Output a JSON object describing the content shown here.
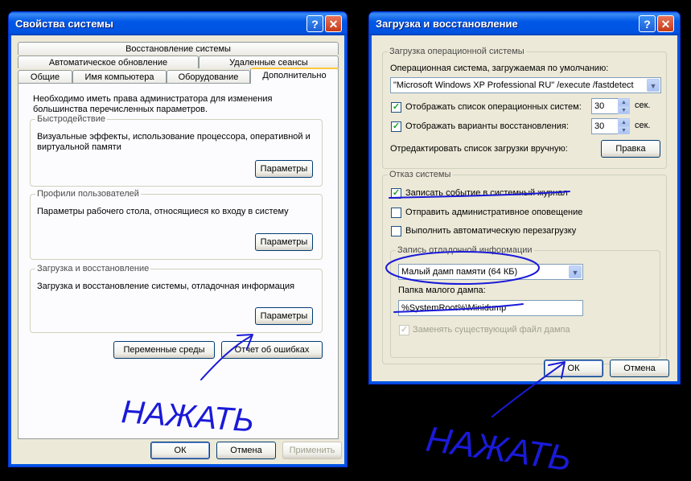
{
  "left_window": {
    "title": "Свойства системы",
    "help_btn": "?",
    "close_btn": "✕",
    "tabs": {
      "row1": [
        "Восстановление системы"
      ],
      "row2": [
        "Автоматическое обновление",
        "Удаленные сеансы"
      ],
      "row3": [
        "Общие",
        "Имя компьютера",
        "Оборудование",
        "Дополнительно"
      ]
    },
    "intro": "Необходимо иметь права администратора для изменения большинства перечисленных параметров.",
    "performance": {
      "title": "Быстродействие",
      "desc": "Визуальные эффекты, использование процессора, оперативной и виртуальной памяти",
      "button": "Параметры"
    },
    "profiles": {
      "title": "Профили пользователей",
      "desc": "Параметры рабочего стола, относящиеся ко входу в систему",
      "button": "Параметры"
    },
    "startup": {
      "title": "Загрузка и восстановление",
      "desc": "Загрузка и восстановление системы, отладочная информация",
      "button": "Параметры"
    },
    "env_button": "Переменные среды",
    "error_button": "Отчет об ошибках",
    "ok": "ОК",
    "cancel": "Отмена",
    "apply": "Применить"
  },
  "right_window": {
    "title": "Загрузка и восстановление",
    "help_btn": "?",
    "close_btn": "✕",
    "os_group": {
      "title": "Загрузка операционной системы",
      "default_os_label": "Операционная система, загружаемая по умолчанию:",
      "default_os_value": "\"Microsoft Windows XP Professional RU\" /execute /fastdetect",
      "show_list_label": "Отображать список операционных систем:",
      "show_list_value": "30",
      "show_recovery_label": "Отображать варианты восстановления:",
      "show_recovery_value": "30",
      "unit": "сек.",
      "edit_label": "Отредактировать список загрузки вручную:",
      "edit_button": "Правка"
    },
    "failure_group": {
      "title": "Отказ системы",
      "write_event": "Записать событие в системный журнал",
      "send_alert": "Отправить административное оповещение",
      "auto_restart": "Выполнить автоматическую перезагрузку"
    },
    "debug_group": {
      "title": "Запись отладочной информации",
      "dump_type": "Малый дамп памяти (64 КБ)",
      "folder_label": "Папка малого дампа:",
      "folder_value": "%SystemRoot%\\Minidump",
      "overwrite": "Заменять существующий файл дампа"
    },
    "ok": "ОК",
    "cancel": "Отмена"
  },
  "checks": {
    "show_list": true,
    "show_recovery": true,
    "write_event": true,
    "send_alert": false,
    "auto_restart": false,
    "overwrite": true
  },
  "glyphs": {
    "check": "✓",
    "arrow_down": "▼",
    "arrow_up": "▲"
  },
  "annotations": {
    "press_left": "НАЖАТЬ",
    "press_right": "НАЖАТЬ"
  },
  "colors": {
    "ink": "#1a1ad8",
    "title_blue": "#0054e3"
  }
}
